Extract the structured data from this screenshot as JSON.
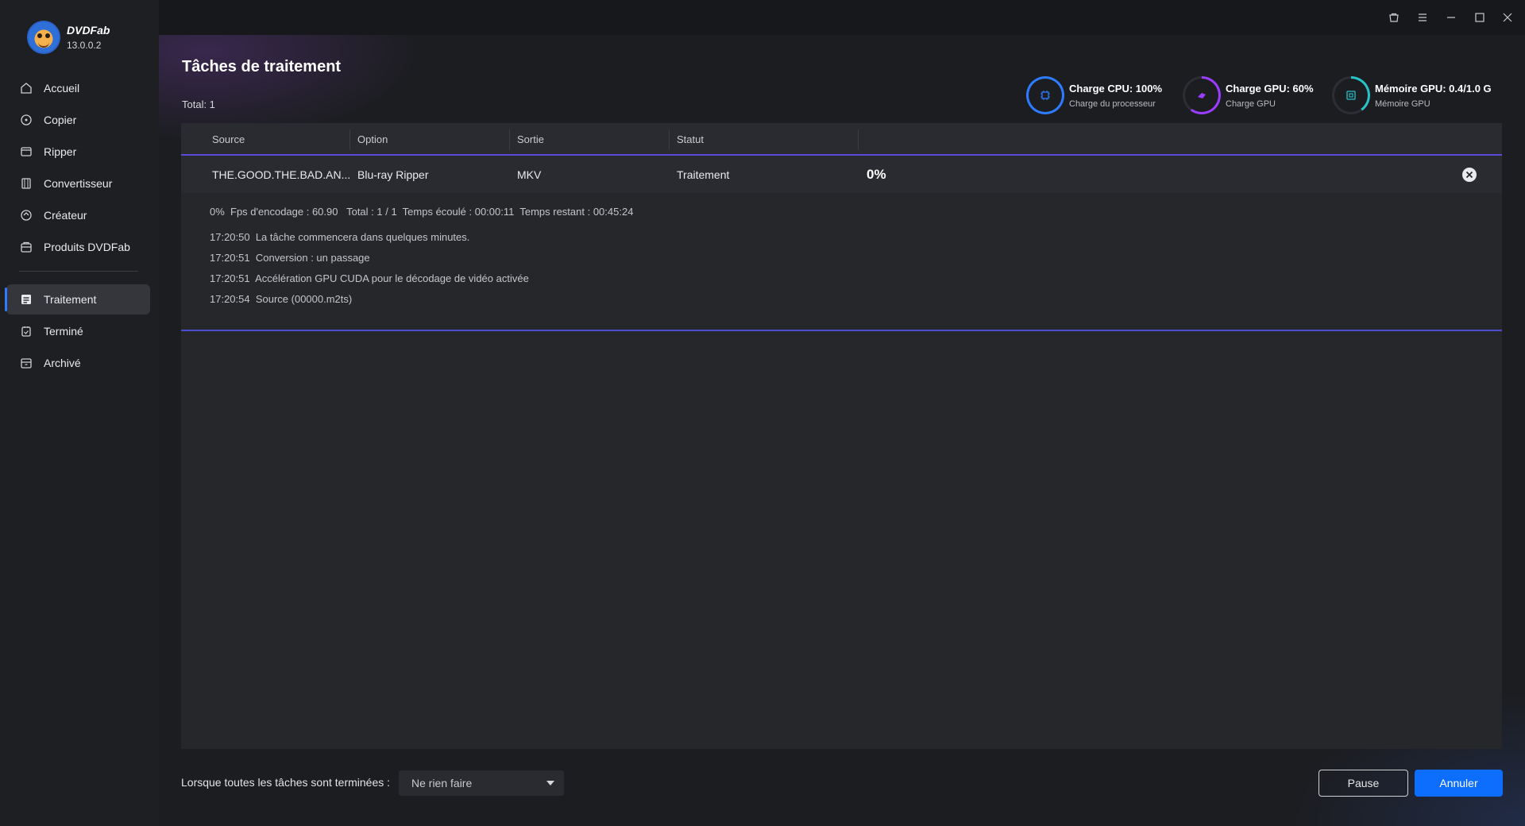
{
  "app": {
    "name": "DVDFab",
    "version": "13.0.0.2"
  },
  "sidebar": {
    "items": [
      {
        "label": "Accueil",
        "icon": "home-icon"
      },
      {
        "label": "Copier",
        "icon": "copy-icon"
      },
      {
        "label": "Ripper",
        "icon": "ripper-icon"
      },
      {
        "label": "Convertisseur",
        "icon": "converter-icon"
      },
      {
        "label": "Créateur",
        "icon": "creator-icon"
      },
      {
        "label": "Produits DVDFab",
        "icon": "products-icon"
      }
    ],
    "task_items": [
      {
        "label": "Traitement",
        "icon": "processing-icon",
        "active": true
      },
      {
        "label": "Terminé",
        "icon": "finished-icon"
      },
      {
        "label": "Archivé",
        "icon": "archive-icon"
      }
    ]
  },
  "header": {
    "title": "Tâches de traitement",
    "total": "Total: 1"
  },
  "stats": {
    "cpu": {
      "title": "Charge CPU: 100%",
      "subtitle": "Charge du processeur",
      "value": 100,
      "color": "#2f7bff"
    },
    "gpu": {
      "title": "Charge GPU: 60%",
      "subtitle": "Charge GPU",
      "value": 60,
      "color": "#9b3dff"
    },
    "gpu_memory": {
      "title": "Mémoire GPU: 0.4/1.0 G",
      "subtitle": "Mémoire GPU",
      "value": 40,
      "color": "#27c3c9"
    }
  },
  "table": {
    "headers": {
      "source": "Source",
      "option": "Option",
      "output": "Sortie",
      "status": "Statut"
    },
    "task": {
      "source": "THE.GOOD.THE.BAD.AN...",
      "option": "Blu-ray Ripper",
      "output": "MKV",
      "status": "Traitement",
      "progress": "0%"
    },
    "details": {
      "summary": "0%  Fps d'encodage : 60.90   Total : 1 / 1  Temps écoulé : 00:00:11  Temps restant : 00:45:24",
      "log": [
        "17:20:50  La tâche commencera dans quelques minutes.",
        "17:20:51  Conversion : un passage",
        "17:20:51  Accélération GPU CUDA pour le décodage de vidéo activée",
        "17:20:54  Source (00000.m2ts)"
      ]
    }
  },
  "footer": {
    "label": "Lorsque toutes les tâches sont terminées :",
    "select_value": "Ne rien faire",
    "pause_label": "Pause",
    "cancel_label": "Annuler"
  },
  "colors": {
    "accent": "#0d6efd",
    "sidebar_active": "#34363c"
  }
}
